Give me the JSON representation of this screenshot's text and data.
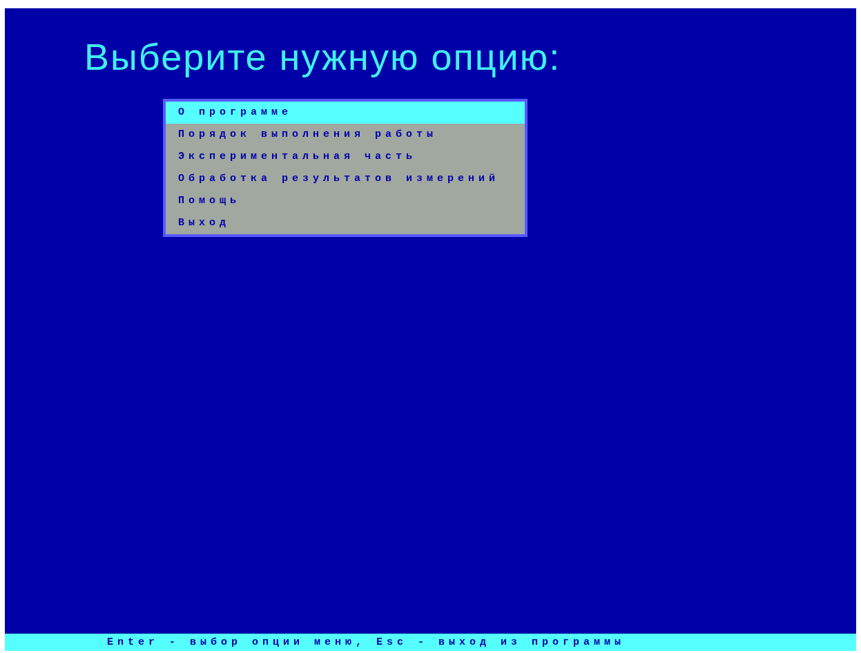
{
  "title": "Выберите нужную опцию:",
  "menu": [
    {
      "label": "О программе",
      "selected": true
    },
    {
      "label": "Порядок выполнения работы",
      "selected": false
    },
    {
      "label": "Экспериментальная часть",
      "selected": false
    },
    {
      "label": "Обработка результатов измерений",
      "selected": false
    },
    {
      "label": "Помощь",
      "selected": false
    },
    {
      "label": "Выход",
      "selected": false
    }
  ],
  "status_bar": "Enter - выбор опции меню, Esc - выход из программы"
}
